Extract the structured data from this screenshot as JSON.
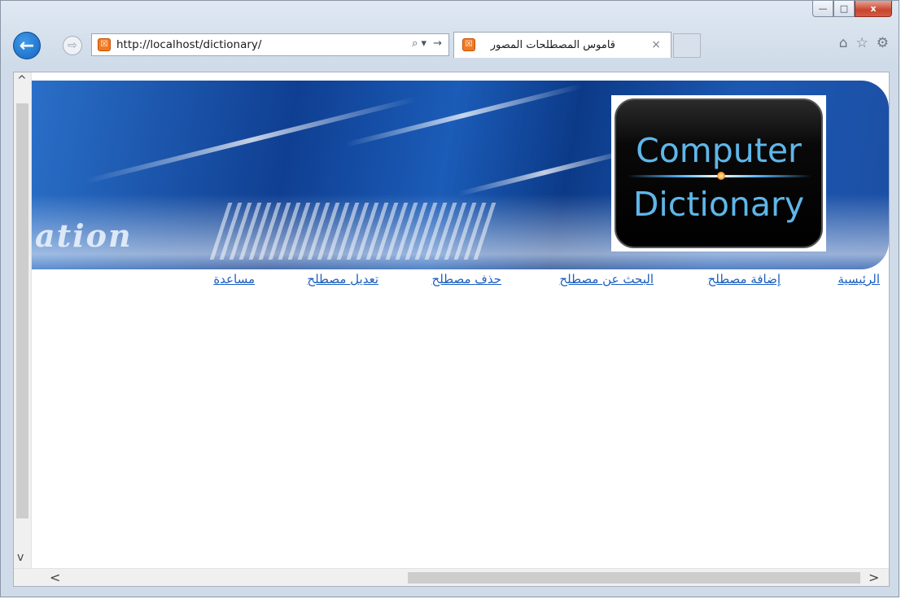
{
  "window": {
    "caption": {
      "minimize": "—",
      "maximize": "□",
      "close": "x"
    }
  },
  "toolbar": {
    "back_icon": "←",
    "forward_icon": "⇨",
    "address": "http://localhost/dictionary/",
    "address_tools": [
      "⌕ ▾",
      "→"
    ],
    "tab_title": "قاموس المصطلحات المصور",
    "tab_close": "×",
    "right_icons": [
      "⌂",
      "☆",
      "⚙"
    ]
  },
  "favicon_glyph": "☒",
  "banner": {
    "word": "ation",
    "logo_line1": "Computer",
    "logo_line2": "Dictionary"
  },
  "nav": {
    "items": [
      "الرئيسية",
      "إضافة مصطلح",
      "البحث عن مصطلح",
      "حذف مصطلح",
      "تعديل مصطلح",
      "مساعدة"
    ]
  },
  "scrollbars": {
    "up": "^",
    "down": "v",
    "left": "<",
    "right": ">"
  },
  "colors": {
    "link": "#1b5fc0",
    "banner_blue": "#0f3f92",
    "favicon": "#f07a22"
  }
}
